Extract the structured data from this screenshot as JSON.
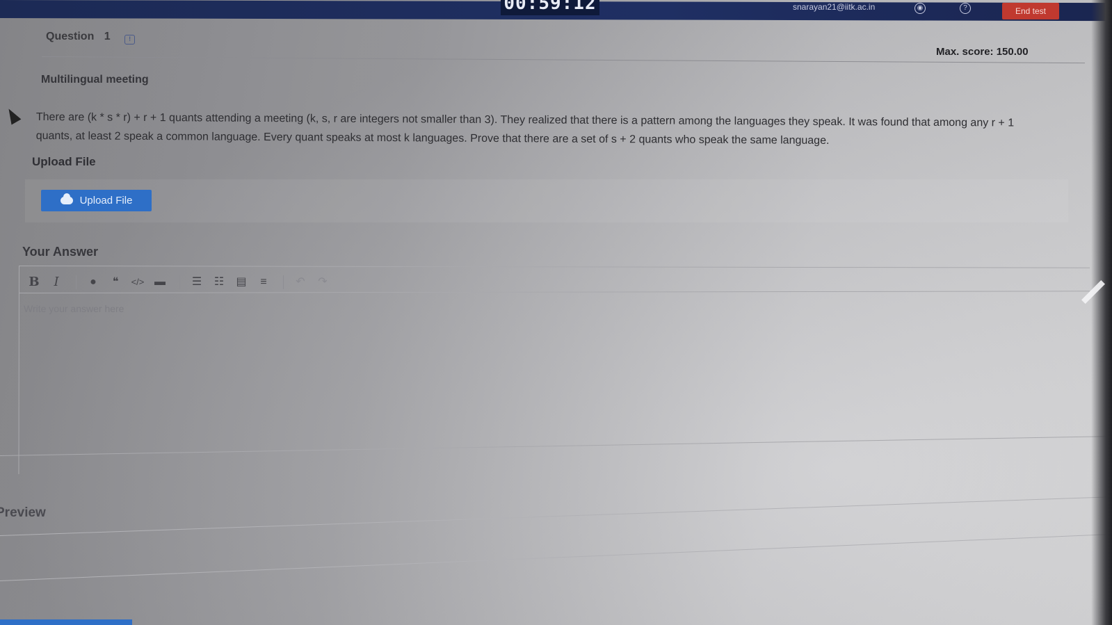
{
  "topbar": {
    "timer": "00:59:12",
    "user_email": "snarayan21@iitk.ac.in",
    "end_test_label": "End test"
  },
  "question": {
    "label": "Question",
    "number": "1",
    "max_score": "Max. score: 150.00",
    "title": "Multilingual meeting",
    "text": "There are (k * s * r) + r + 1 quants attending a meeting (k, s, r are integers not smaller than 3). They realized that there is a pattern among the languages they speak. It was found that among any r + 1 quants, at least 2 speak a common language. Every quant speaks at most k languages. Prove that there are a set of s + 2 quants who speak the same language."
  },
  "upload": {
    "section_label": "Upload File",
    "button_label": "Upload File"
  },
  "answer": {
    "section_label": "Your Answer",
    "placeholder": "Write your answer here"
  },
  "preview": {
    "label": "Preview"
  },
  "toolbar_icons": [
    "bold-icon",
    "italic-icon",
    "image-icon",
    "quote-icon",
    "code-icon",
    "code-block-icon",
    "ordered-list-icon",
    "unordered-list-icon",
    "indent-icon",
    "outdent-icon",
    "undo-icon",
    "redo-icon"
  ],
  "colors": {
    "topbar": "#1c2a55",
    "end_test": "#c0392f",
    "upload_button": "#2e6fc7"
  }
}
